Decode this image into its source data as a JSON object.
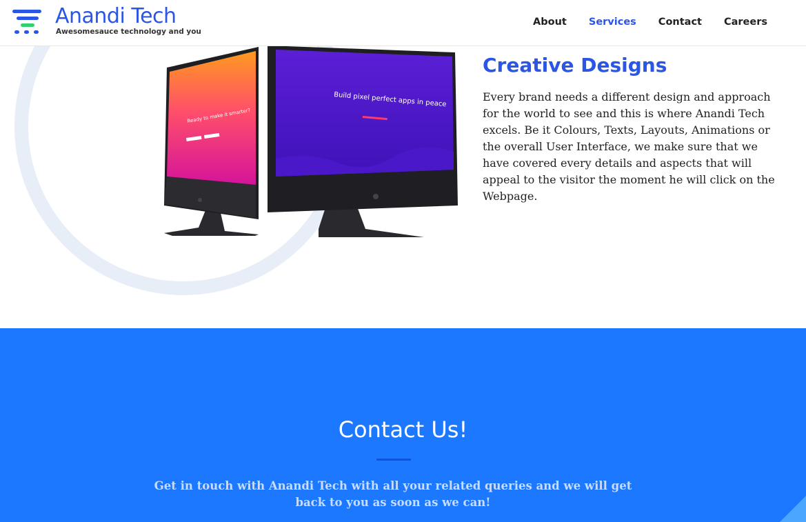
{
  "header": {
    "logo_title": "Anandi Tech",
    "logo_subtitle": "Awesomesauce technology and you",
    "nav": [
      {
        "label": "About",
        "active": false
      },
      {
        "label": "Services",
        "active": true
      },
      {
        "label": "Contact",
        "active": false
      },
      {
        "label": "Careers",
        "active": false
      }
    ]
  },
  "design_section": {
    "title": "Creative Designs",
    "text": "Every brand needs a different design and approach for the world to see and this is where Anandi Tech excels. Be it Colours, Texts, Layouts, Animations or the overall User Interface, we make sure that we have covered every details and aspects that will appeal to the visitor the moment he will click on the Webpage.",
    "mockup_left_text": "Ready to make it smarter?",
    "mockup_right_text": "Build pixel perfect apps in peace"
  },
  "contact_section": {
    "title": "Contact Us!",
    "text": "Get in touch with Anandi Tech with all your related queries and we will get back to you as soon as we can!"
  },
  "colors": {
    "brand_blue": "#2a55e5",
    "contact_bg": "#1c78ff",
    "ring": "#e8eef8"
  }
}
